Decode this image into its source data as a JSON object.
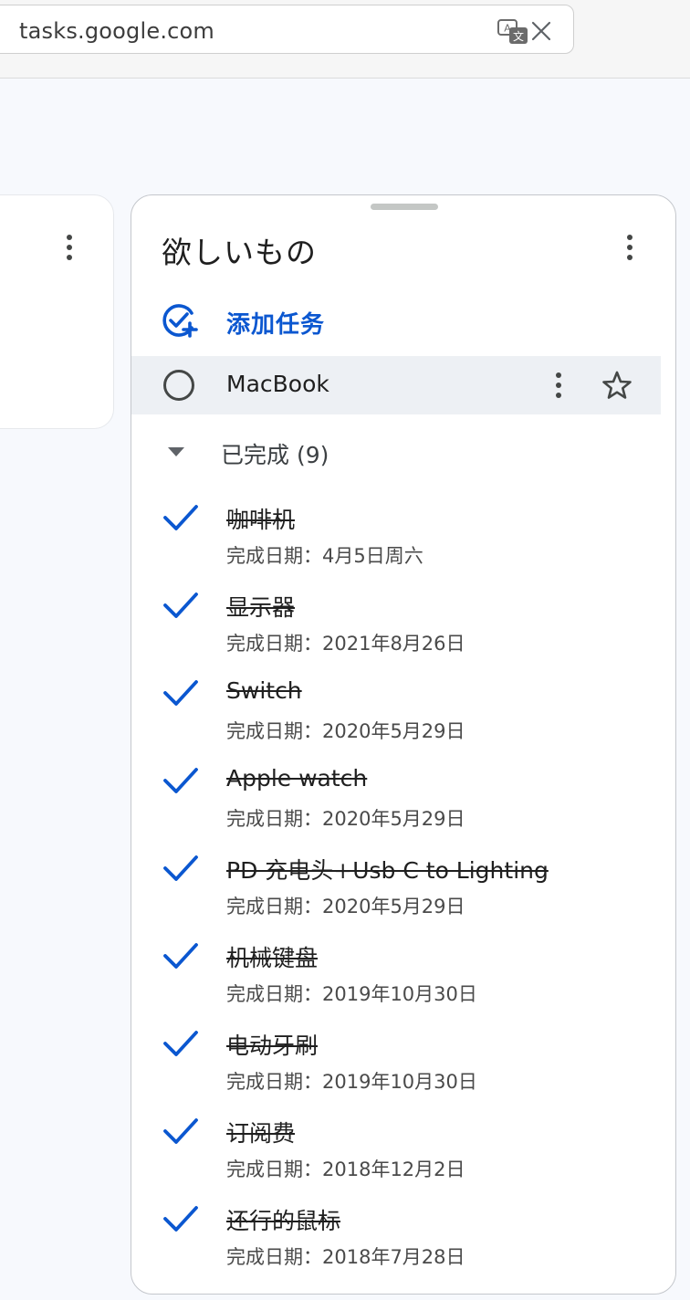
{
  "browser": {
    "url": "tasks.google.com",
    "translate_icon": "translate-icon",
    "close_icon": "close-icon"
  },
  "left_card": {
    "more_icon": "more-vert-icon"
  },
  "panel": {
    "title": "欲しいもの",
    "more_icon": "more-vert-icon",
    "add_task_label": "添加任务",
    "add_task_icon": "add-task-icon",
    "accent_color": "#0b57d0",
    "active_task": {
      "title": "MacBook",
      "more_icon": "more-vert-icon",
      "star_icon": "star-outline-icon"
    },
    "completed": {
      "label": "已完成 (9)",
      "caret_icon": "caret-down-icon",
      "items": [
        {
          "title": "咖啡机",
          "date": "完成日期：4月5日周六"
        },
        {
          "title": "显示器",
          "date": "完成日期：2021年8月26日"
        },
        {
          "title": "Switch",
          "date": "完成日期：2020年5月29日"
        },
        {
          "title": "Apple watch",
          "date": "完成日期：2020年5月29日"
        },
        {
          "title": "PD 充电头+Usb C to Lighting",
          "date": "完成日期：2020年5月29日"
        },
        {
          "title": "机械键盘",
          "date": "完成日期：2019年10月30日"
        },
        {
          "title": "电动牙刷",
          "date": "完成日期：2019年10月30日"
        },
        {
          "title": "订阅费",
          "date": "完成日期：2018年12月2日"
        },
        {
          "title": "还行的鼠标",
          "date": "完成日期：2018年7月28日"
        }
      ]
    }
  }
}
